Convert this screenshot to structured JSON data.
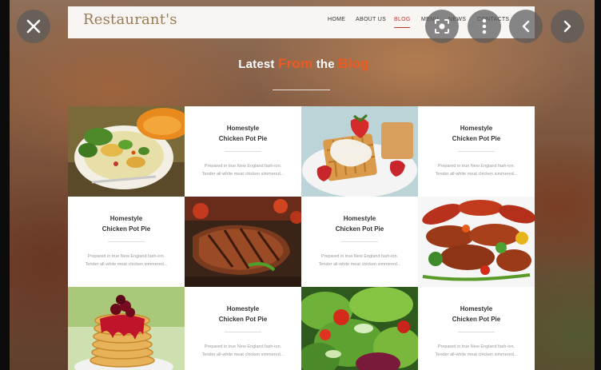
{
  "site": {
    "brand": "Restaurant's",
    "nav": [
      {
        "label": "HOME",
        "active": false
      },
      {
        "label": "ABOUT US",
        "active": false
      },
      {
        "label": "BLOG",
        "active": true
      },
      {
        "label": "MENU",
        "active": false
      },
      {
        "label": "NEWS",
        "active": false
      },
      {
        "label": "CONTACTS",
        "active": false
      }
    ]
  },
  "heading": {
    "part1": "Latest",
    "part2": "From",
    "part3": "the",
    "part4": "Blog"
  },
  "cards": [
    {
      "title_line1": "Homestyle",
      "title_line2": "Chicken Pot Pie",
      "excerpt": "Prepared in true New England fash-ion. Tender all-white meat chicken simmered..."
    },
    {
      "title_line1": "Homestyle",
      "title_line2": "Chicken Pot Pie",
      "excerpt": "Prepared in true New England fash-ion. Tender all-white meat chicken simmered..."
    },
    {
      "title_line1": "Homestyle",
      "title_line2": "Chicken Pot Pie",
      "excerpt": "Prepared in true New England fash-ion. Tender all-white meat chicken simmered..."
    },
    {
      "title_line1": "Homestyle",
      "title_line2": "Chicken Pot Pie",
      "excerpt": "Prepared in true New England fash-ion. Tender all-white meat chicken simmered..."
    },
    {
      "title_line1": "Homestyle",
      "title_line2": "Chicken Pot Pie",
      "excerpt": "Prepared in true New England fash-ion. Tender all-white meat chicken simmered..."
    },
    {
      "title_line1": "Homestyle",
      "title_line2": "Chicken Pot Pie",
      "excerpt": "Prepared in true New England fash-ion. Tender all-white meat chicken simmered..."
    }
  ],
  "photos": [
    {
      "subject": "pasta-salad-bowl"
    },
    {
      "subject": "waffles-strawberries"
    },
    {
      "subject": "grilled-steak"
    },
    {
      "subject": "kebab-skewers"
    },
    {
      "subject": "pancake-stack"
    },
    {
      "subject": "green-salad"
    }
  ],
  "viewer": {
    "buttons": [
      "close-icon",
      "lens-search-icon",
      "more-vertical-icon",
      "chevron-left-icon",
      "chevron-right-icon"
    ]
  },
  "colors": {
    "accent": "#ef5a21",
    "brand": "#9a7a52",
    "nav_active": "#c0392b"
  }
}
